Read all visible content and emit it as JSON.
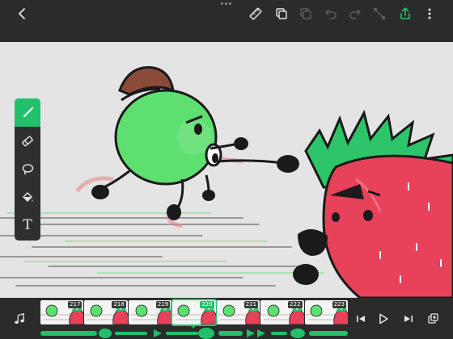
{
  "app": {
    "name": "animation-editor"
  },
  "toolbar": {
    "back_icon": "chevron-left-icon",
    "actions": [
      "ruler-icon",
      "duplicate-layers-icon",
      "paste-icon",
      "undo-icon",
      "redo-icon",
      "transform-icon",
      "share-icon",
      "more-icon"
    ]
  },
  "tools": {
    "items": [
      "brush-icon",
      "eraser-icon",
      "lasso-icon",
      "fill-bucket-icon",
      "text-icon"
    ],
    "active": "brush-icon",
    "text_glyph": "T"
  },
  "timeline": {
    "frames": [
      {
        "num": "217"
      },
      {
        "num": "218"
      },
      {
        "num": "219"
      },
      {
        "num": "220",
        "current": true
      },
      {
        "num": "221"
      },
      {
        "num": "222"
      },
      {
        "num": "223"
      }
    ],
    "current_frame": "220"
  },
  "colors": {
    "accent": "#22c06a",
    "bar": "#2b2b2b",
    "canvas": "#e4e4e4",
    "apple": "#5ee071",
    "strawberry": "#e8415a",
    "leaves": "#2ec56a"
  }
}
